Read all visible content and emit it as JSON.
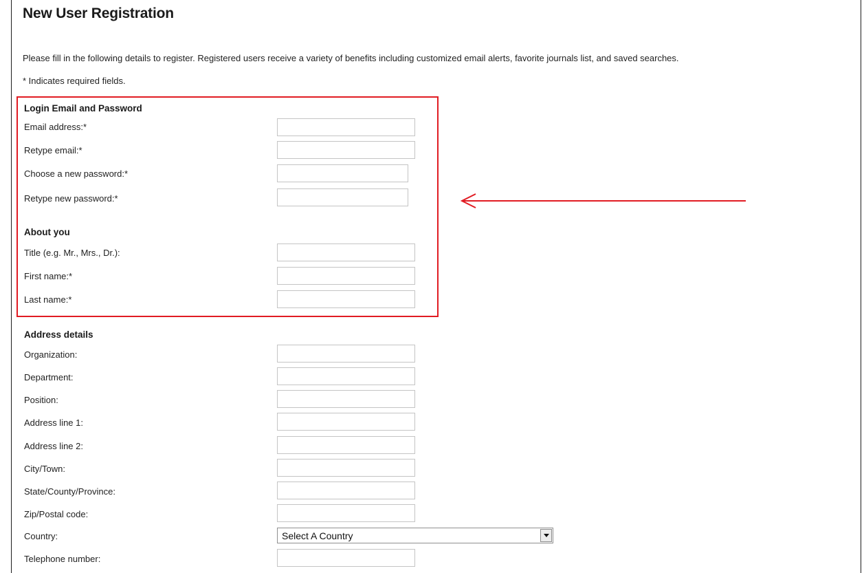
{
  "page": {
    "title": "New User Registration",
    "intro": "Please fill in the following details to register. Registered users receive a variety of benefits including customized email alerts, favorite journals list, and saved searches.",
    "required_note": "* Indicates required fields."
  },
  "login": {
    "heading": "Login Email and Password",
    "fields": [
      {
        "label": "Email address:*",
        "value": ""
      },
      {
        "label": "Retype email:*",
        "value": ""
      },
      {
        "label": "Choose a new password:*",
        "value": ""
      },
      {
        "label": "Retype new password:*",
        "value": ""
      }
    ]
  },
  "about": {
    "heading": "About you",
    "fields": [
      {
        "label": "Title (e.g. Mr., Mrs., Dr.):",
        "value": ""
      },
      {
        "label": "First name:*",
        "value": ""
      },
      {
        "label": "Last name:*",
        "value": ""
      }
    ]
  },
  "address": {
    "heading": "Address details",
    "fields": [
      {
        "label": "Organization:",
        "value": ""
      },
      {
        "label": "Department:",
        "value": ""
      },
      {
        "label": "Position:",
        "value": ""
      },
      {
        "label": "Address line 1:",
        "value": ""
      },
      {
        "label": "Address line 2:",
        "value": ""
      },
      {
        "label": "City/Town:",
        "value": ""
      },
      {
        "label": "State/County/Province:",
        "value": ""
      },
      {
        "label": "Zip/Postal code:",
        "value": ""
      }
    ],
    "country": {
      "label": "Country:",
      "selected": "Select A Country"
    },
    "telephone": {
      "label": "Telephone number:",
      "value": ""
    }
  },
  "annotation": {
    "color": "#e11b22",
    "icon": "left-arrow-icon"
  }
}
